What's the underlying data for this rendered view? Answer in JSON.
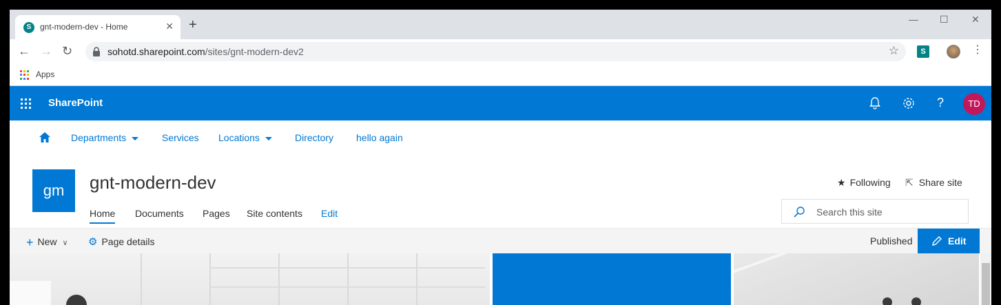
{
  "browser": {
    "tab_title": "gnt-modern-dev - Home",
    "tab_favicon_letter": "S",
    "new_tab_symbol": "+",
    "url_host": "sohotd.sharepoint.com",
    "url_path": "/sites/gnt-modern-dev2",
    "extension_letter": "S",
    "bookmarks": [
      {
        "label": "Apps"
      }
    ]
  },
  "suitebar": {
    "brand": "SharePoint",
    "avatar_initials": "TD",
    "color": "#0078d4"
  },
  "hubnav": {
    "items": [
      {
        "label": "Departments",
        "has_dropdown": true
      },
      {
        "label": "Services",
        "has_dropdown": false
      },
      {
        "label": "Locations",
        "has_dropdown": true
      },
      {
        "label": "Directory",
        "has_dropdown": false
      },
      {
        "label": "hello again",
        "has_dropdown": false
      }
    ]
  },
  "site": {
    "logo_text": "gm",
    "title": "gnt-modern-dev",
    "nav": [
      {
        "label": "Home",
        "active": true
      },
      {
        "label": "Documents"
      },
      {
        "label": "Pages"
      },
      {
        "label": "Site contents"
      },
      {
        "label": "Edit"
      }
    ],
    "following_label": "Following",
    "share_label": "Share site",
    "search_placeholder": "Search this site"
  },
  "commandbar": {
    "new_label": "New",
    "page_details_label": "Page details",
    "status": "Published",
    "edit_label": "Edit"
  }
}
